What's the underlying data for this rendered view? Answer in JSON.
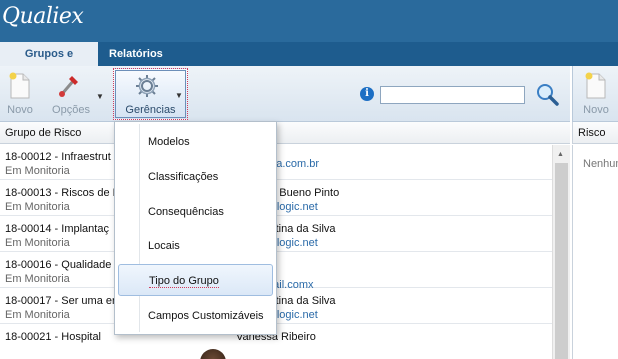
{
  "app": {
    "logo_text": "Qualiex"
  },
  "tabs": [
    {
      "label": "Grupos e Riscos",
      "active": true
    },
    {
      "label": "Relatórios",
      "active": false
    }
  ],
  "toolbar": {
    "novo_label": "Novo",
    "opcoes_label": "Opções",
    "gerencias_label": "Gerências"
  },
  "search": {
    "value": "",
    "placeholder": ""
  },
  "right_panel": {
    "novo_label": "Novo",
    "column_header": "Risco",
    "empty_text": "Nenhum"
  },
  "table": {
    "column_header": "Grupo de Risco",
    "rows": [
      {
        "title": "18-00012 - Infraestrut",
        "status": "Em Monitoria",
        "person": "",
        "email": "aha.com.br"
      },
      {
        "title": "18-00013 - Riscos de N",
        "status": "Em Monitoria",
        "person": "rla Bueno Pinto",
        "email": "forlogic.net"
      },
      {
        "title": "18-00014 - Implantaç",
        "status": "Em Monitoria",
        "person": "ristina da Silva",
        "email": "forlogic.net"
      },
      {
        "title": "18-00016 - Qualidade",
        "status": "Em Monitoria",
        "person": "",
        "email": "mail.comx"
      },
      {
        "title": "18-00017 - Ser uma er",
        "status": "Em Monitoria",
        "person": "ristina da Silva",
        "email": "forlogic.net"
      },
      {
        "title": "18-00021 - Hospital",
        "status": "",
        "person": "Vanessa Ribeiro",
        "email": ""
      }
    ]
  },
  "menu": {
    "items": [
      {
        "label": "Modelos"
      },
      {
        "label": "Classificações"
      },
      {
        "label": "Consequências"
      },
      {
        "label": "Locais"
      },
      {
        "label": "Tipo do Grupo",
        "hovered": true
      },
      {
        "label": "Campos Customizáveis"
      }
    ]
  },
  "colors": {
    "header_bg": "#2a6a9c",
    "tabbar_bg": "#1e5c8e",
    "link": "#2a6aa8"
  }
}
